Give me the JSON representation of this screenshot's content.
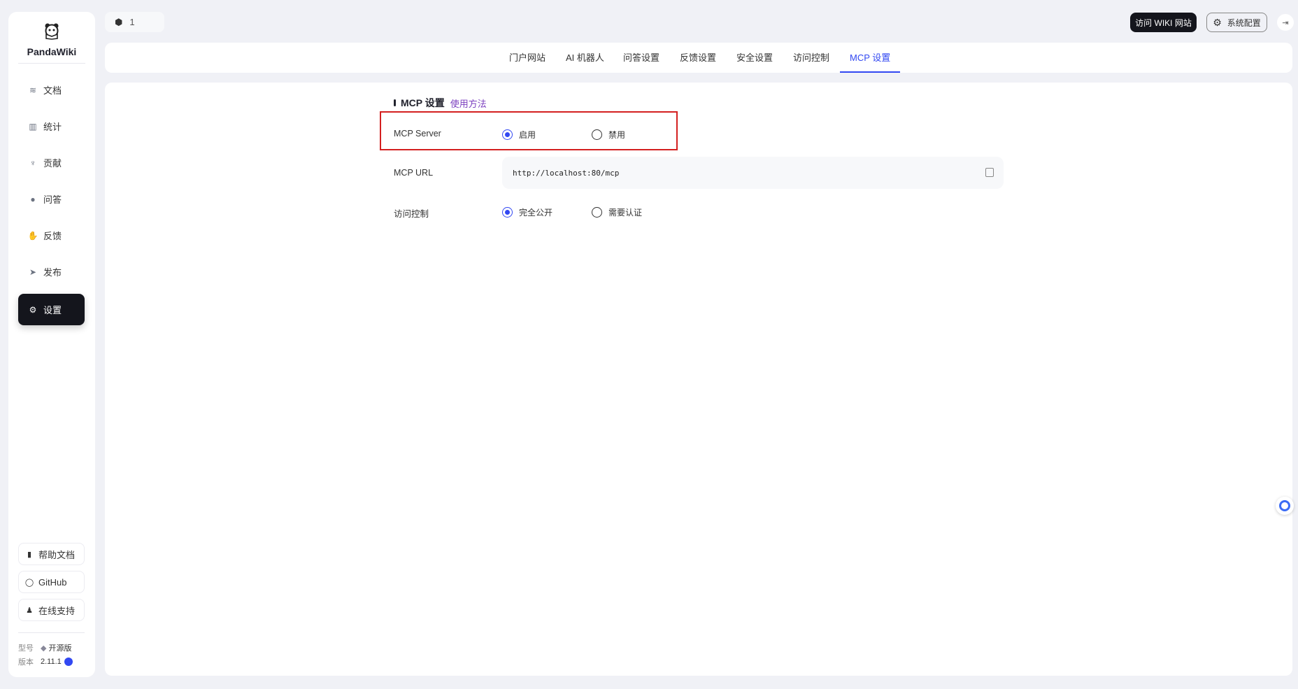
{
  "app": {
    "name": "PandaWiki"
  },
  "workspace": {
    "label": "1"
  },
  "sidebar": {
    "items": [
      {
        "label": "文档",
        "icon": "layers-icon"
      },
      {
        "label": "统计",
        "icon": "bar-chart-icon"
      },
      {
        "label": "贡献",
        "icon": "trophy-icon"
      },
      {
        "label": "问答",
        "icon": "chat-icon"
      },
      {
        "label": "反馈",
        "icon": "hand-icon"
      },
      {
        "label": "发布",
        "icon": "send-icon"
      },
      {
        "label": "设置",
        "icon": "gear-icon"
      }
    ],
    "bottom": [
      {
        "label": "帮助文档"
      },
      {
        "label": "GitHub"
      },
      {
        "label": "在线支持"
      }
    ],
    "model_label": "型号",
    "model_value": "开源版",
    "version_label": "版本",
    "version_value": "2.11.1"
  },
  "header": {
    "visit_wiki": "访问 WIKI 网站",
    "system_config": "系统配置"
  },
  "tabs": [
    "门户网站",
    "AI 机器人",
    "问答设置",
    "反馈设置",
    "安全设置",
    "访问控制",
    "MCP 设置"
  ],
  "mcp": {
    "title": "MCP 设置",
    "help_link": "使用方法",
    "server_label": "MCP Server",
    "server_options": [
      "启用",
      "禁用"
    ],
    "url_label": "MCP URL",
    "url_value": "http://localhost:80/mcp",
    "access_label": "访问控制",
    "access_options": [
      "完全公开",
      "需要认证"
    ]
  },
  "colors": {
    "accent": "#3248f2",
    "dark": "#14151c",
    "highlight": "#d42020"
  }
}
